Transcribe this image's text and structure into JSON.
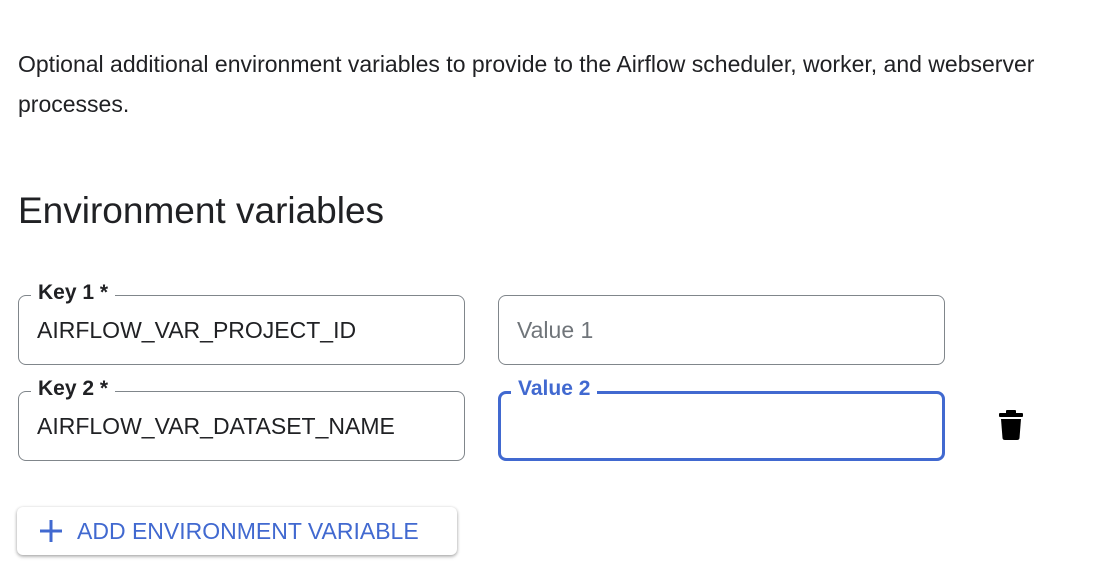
{
  "description": "Optional additional environment variables to provide to the Airflow scheduler, worker, and webserver processes.",
  "heading": "Environment variables",
  "rows": [
    {
      "key_label": "Key 1 *",
      "key_value": "AIRFLOW_VAR_PROJECT_ID",
      "value_placeholder": "Value 1",
      "value": ""
    },
    {
      "key_label": "Key 2 *",
      "key_value": "AIRFLOW_VAR_DATASET_NAME",
      "value_label": "Value 2",
      "value": ""
    }
  ],
  "add_button": "ADD ENVIRONMENT VARIABLE",
  "colors": {
    "accent": "#4169d0",
    "border": "#80868b"
  },
  "icons": {
    "delete": "trash-icon",
    "add": "plus-icon"
  }
}
